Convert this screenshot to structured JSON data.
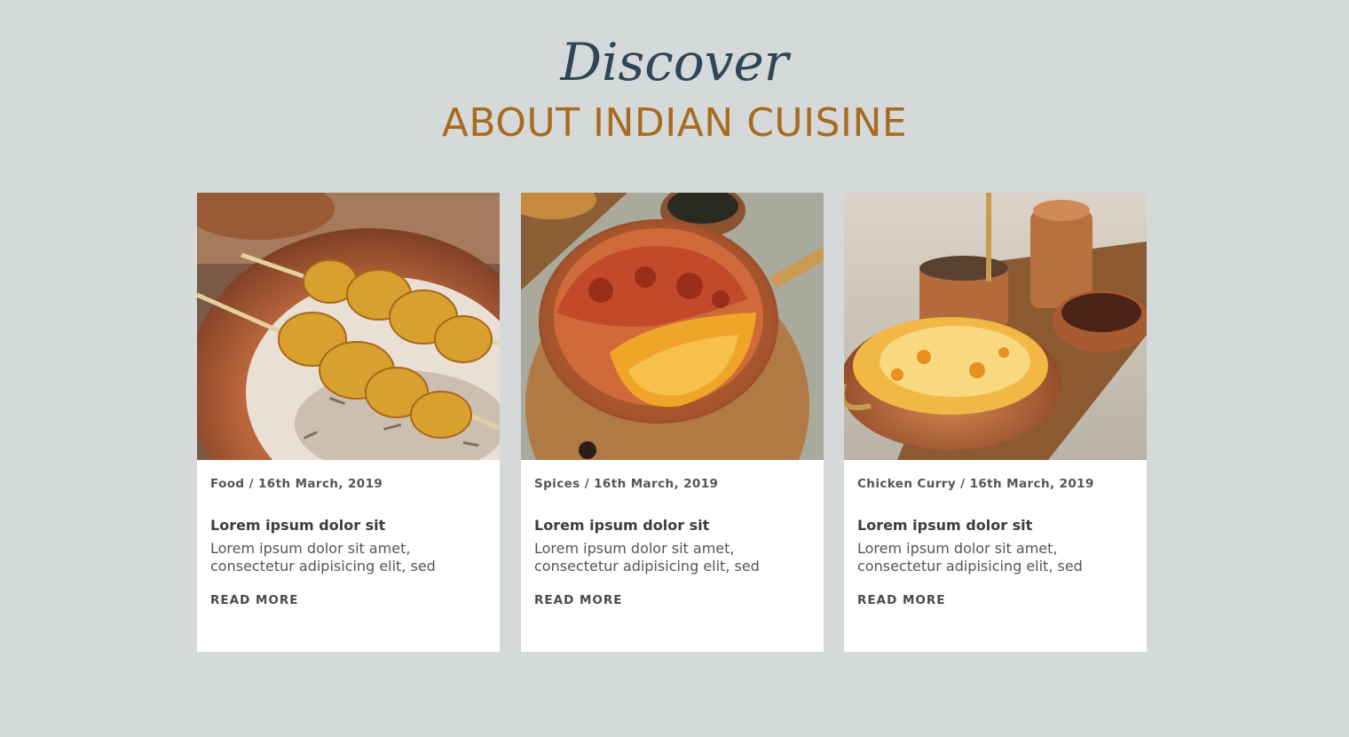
{
  "header": {
    "script_title": "Discover",
    "main_title": "ABOUT INDIAN CUISINE"
  },
  "cards": [
    {
      "category": "Food",
      "date": "16th March, 2019",
      "meta": "Food / 16th March, 2019",
      "heading": "Lorem ipsum dolor sit",
      "excerpt": "Lorem ipsum dolor sit amet, consectetur adipisicing elit, sed",
      "link": "READ MORE",
      "image": "chicken-skewers-on-rice"
    },
    {
      "category": "Spices",
      "date": "16th March, 2019",
      "meta": "Spices / 16th March, 2019",
      "heading": "Lorem ipsum dolor sit",
      "excerpt": "Lorem ipsum dolor sit amet, consectetur adipisicing elit, sed",
      "link": "READ MORE",
      "image": "curry-and-rice-pan"
    },
    {
      "category": "Chicken Curry",
      "date": "16th March, 2019",
      "meta": "Chicken Curry / 16th March, 2019",
      "heading": "Lorem ipsum dolor sit",
      "excerpt": "Lorem ipsum dolor sit amet, consectetur adipisicing elit, sed",
      "link": "READ MORE",
      "image": "biryani-in-copper-bowl"
    }
  ],
  "colors": {
    "background": "#d5d9da",
    "script_title": "#2f4755",
    "main_title": "#a86b1f",
    "card_bg": "#ffffff"
  }
}
